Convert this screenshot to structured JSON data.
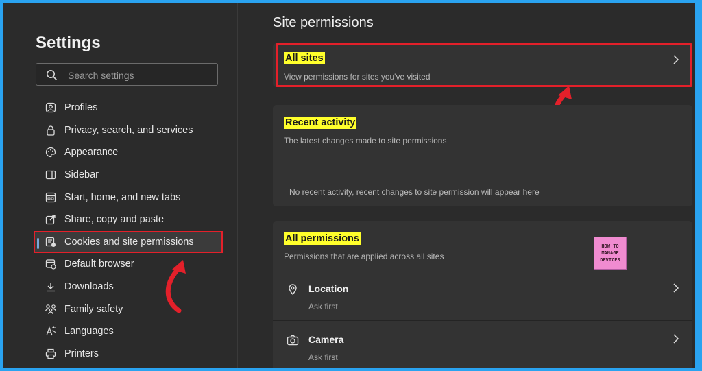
{
  "sidebar": {
    "title": "Settings",
    "search_placeholder": "Search settings",
    "items": [
      {
        "label": "Profiles",
        "icon": "profile-icon"
      },
      {
        "label": "Privacy, search, and services",
        "icon": "lock-icon"
      },
      {
        "label": "Appearance",
        "icon": "palette-icon"
      },
      {
        "label": "Sidebar",
        "icon": "sidebar-icon"
      },
      {
        "label": "Start, home, and new tabs",
        "icon": "home-tabs-icon"
      },
      {
        "label": "Share, copy and paste",
        "icon": "share-icon"
      },
      {
        "label": "Cookies and site permissions",
        "icon": "cookies-icon",
        "active": true
      },
      {
        "label": "Default browser",
        "icon": "browser-icon"
      },
      {
        "label": "Downloads",
        "icon": "download-icon"
      },
      {
        "label": "Family safety",
        "icon": "family-icon"
      },
      {
        "label": "Languages",
        "icon": "languages-icon"
      },
      {
        "label": "Printers",
        "icon": "printer-icon"
      }
    ]
  },
  "main": {
    "title": "Site permissions",
    "all_sites": {
      "title": "All sites",
      "desc": "View permissions for sites you've visited"
    },
    "recent_activity": {
      "title": "Recent activity",
      "desc": "The latest changes made to site permissions",
      "empty": "No recent activity, recent changes to site permission will appear here"
    },
    "all_permissions": {
      "title": "All permissions",
      "desc": "Permissions that are applied across all sites",
      "items": [
        {
          "title": "Location",
          "sub": "Ask first",
          "icon": "location-icon"
        },
        {
          "title": "Camera",
          "sub": "Ask first",
          "icon": "camera-icon"
        }
      ]
    }
  },
  "watermark": {
    "line1": "HOW TO",
    "line2": "MANAGE",
    "line3": "DEVICES"
  },
  "colors": {
    "highlight": "#ffff2b",
    "callout": "#e3202a",
    "border": "#2aa3f0"
  }
}
